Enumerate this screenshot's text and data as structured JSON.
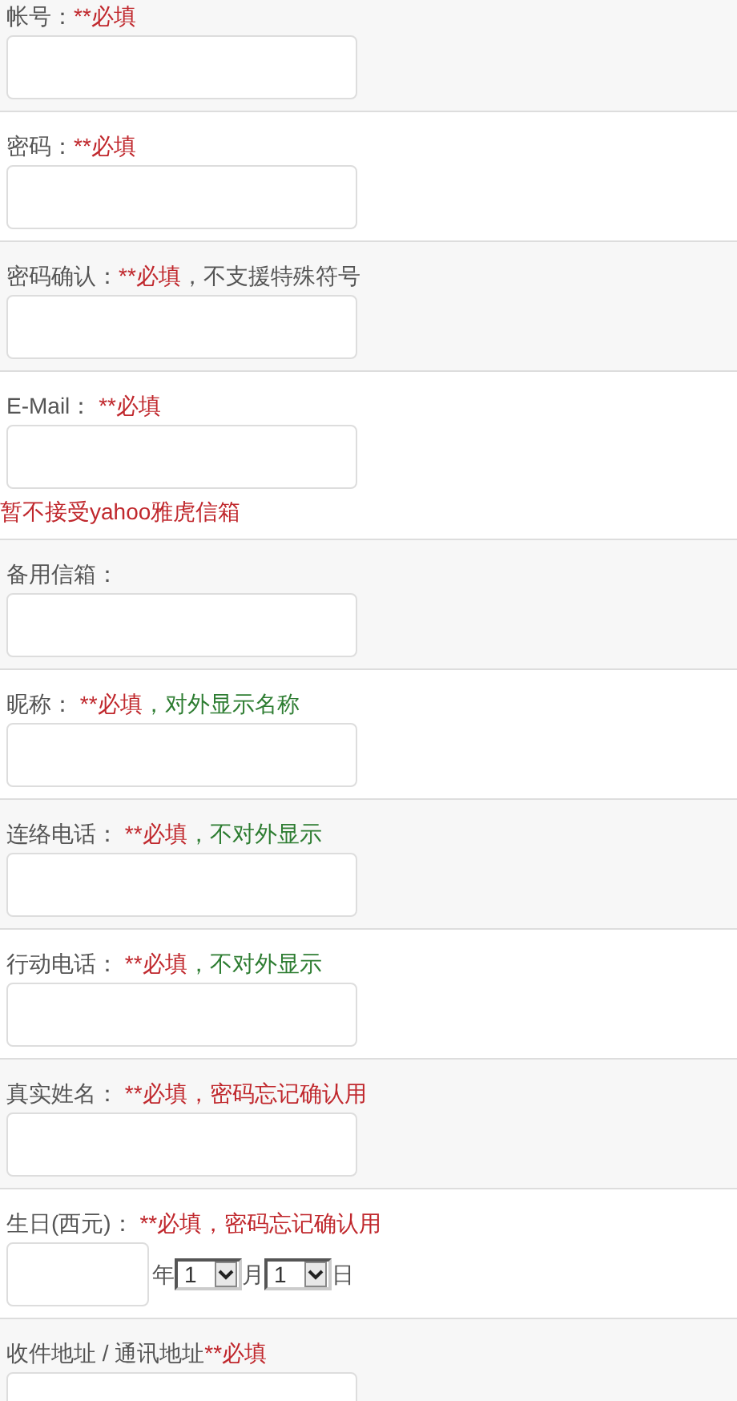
{
  "fields": [
    {
      "kind": "text",
      "label": [
        {
          "kind": "plain",
          "text": "帐号："
        },
        {
          "kind": "required",
          "text": "**必填"
        }
      ]
    },
    {
      "kind": "text",
      "label": [
        {
          "kind": "plain",
          "text": "密码："
        },
        {
          "kind": "required",
          "text": "**必填"
        }
      ]
    },
    {
      "kind": "text",
      "label": [
        {
          "kind": "plain",
          "text": "密码确认："
        },
        {
          "kind": "required",
          "text": "**必填"
        },
        {
          "kind": "plain",
          "text": "，不支援特殊符号"
        }
      ]
    },
    {
      "kind": "text",
      "label": [
        {
          "kind": "plain",
          "text": "E-Mail： "
        },
        {
          "kind": "required",
          "text": "**必填"
        }
      ],
      "note": "暂不接受yahoo雅虎信箱"
    },
    {
      "kind": "text",
      "label": [
        {
          "kind": "plain",
          "text": "备用信箱："
        }
      ]
    },
    {
      "kind": "text",
      "label": [
        {
          "kind": "plain",
          "text": "昵称： "
        },
        {
          "kind": "required",
          "text": "**必填"
        },
        {
          "kind": "info",
          "text": "，对外显示名称"
        }
      ]
    },
    {
      "kind": "text",
      "label": [
        {
          "kind": "plain",
          "text": "连络电话： "
        },
        {
          "kind": "required",
          "text": "**必填"
        },
        {
          "kind": "info",
          "text": "，不对外显示"
        }
      ]
    },
    {
      "kind": "text",
      "label": [
        {
          "kind": "plain",
          "text": "行动电话： "
        },
        {
          "kind": "required",
          "text": "**必填"
        },
        {
          "kind": "info",
          "text": "，不对外显示"
        }
      ]
    },
    {
      "kind": "text",
      "label": [
        {
          "kind": "plain",
          "text": "真实姓名： "
        },
        {
          "kind": "required",
          "text": "**必填"
        },
        {
          "kind": "required",
          "text": "，密码忘记确认用"
        }
      ]
    },
    {
      "kind": "date",
      "label": [
        {
          "kind": "plain",
          "text": "生日(西元)： "
        },
        {
          "kind": "required",
          "text": "**必填"
        },
        {
          "kind": "required",
          "text": "，密码忘记确认用"
        }
      ],
      "year_unit": "年",
      "month": "1",
      "month_unit": "月",
      "day": "1",
      "day_unit": "日"
    },
    {
      "kind": "text",
      "label": [
        {
          "kind": "plain",
          "text": "收件地址 / 通讯地址"
        },
        {
          "kind": "required",
          "text": "**必填"
        }
      ]
    }
  ]
}
